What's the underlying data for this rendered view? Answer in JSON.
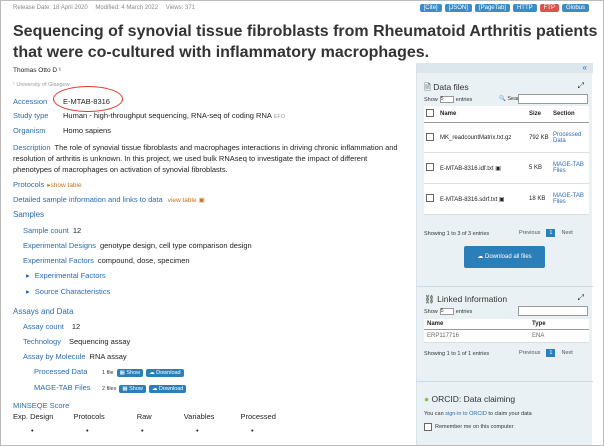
{
  "meta": {
    "release": "Release Date: 18 April 2020",
    "modified": "Modified: 4 March 2022",
    "views": "Views: 371"
  },
  "export_buttons": [
    "[Cite]",
    "[JSON]",
    "[PageTab]",
    "HTTP",
    "FTP",
    "Globus"
  ],
  "title": "Sequencing of synovial tissue fibroblasts from Rheumatoid Arthritis patients that were co-cultured with inflammatory macrophages.",
  "author": "Thomas Otto D ¹",
  "affiliation": "¹ University of Glasgow",
  "accession": {
    "label": "Accession",
    "value": "E-MTAB-8316"
  },
  "study_type": {
    "label": "Study type",
    "value": "Human - high-throughput sequencing, RNA-seq of coding RNA",
    "tag": "EFO"
  },
  "organism": {
    "label": "Organism",
    "value": "Homo sapiens"
  },
  "description": {
    "label": "Description",
    "text": "The role of synovial tissue fibroblasts and macrophages interactions in driving chronic inflammation and resolution of arthritis is unknown. In this project, we used bulk RNAseq to investigate the impact of different phenotypes of macrophages on activation of synovial fibroblasts."
  },
  "protocols": {
    "label": "Protocols",
    "action": "show table"
  },
  "detailed": {
    "label": "Detailed sample information and links to data",
    "action": "view table"
  },
  "samples": {
    "heading": "Samples",
    "count_label": "Sample count",
    "count_value": "12",
    "designs_label": "Experimental Designs",
    "designs_value": "genotype design, cell type comparison design",
    "factors_label": "Experimental Factors",
    "factors_value": "compound, dose, specimen",
    "expand1": "Experimental Factors",
    "expand2": "Source Characteristics"
  },
  "assays": {
    "heading": "Assays and Data",
    "count_label": "Assay count",
    "count_value": "12",
    "tech_label": "Technology",
    "tech_value": "Sequencing assay",
    "molecule_label": "Assay by Molecule",
    "molecule_value": "RNA assay",
    "processed_label": "Processed Data",
    "processed_files": "1 file",
    "magetab_label": "MAGE-TAB Files",
    "magetab_files": "2 files",
    "show_label": "Show",
    "download_label": "Download"
  },
  "minseqe": {
    "heading": "MINSEQE Score",
    "columns": [
      "Exp. Design",
      "Protocols",
      "Raw",
      "Variables",
      "Processed"
    ],
    "values": [
      "•",
      "•",
      "•",
      "•",
      "•"
    ]
  },
  "data_files": {
    "title": "Data files",
    "show": "Show",
    "show_value": "5",
    "entries": "entries",
    "search_label": "Search:",
    "headers": [
      "Name",
      "Size",
      "Section"
    ],
    "rows": [
      {
        "name": "MK_readcountMatrix.txt.gz",
        "size": "792 KB",
        "section": "Processed Data"
      },
      {
        "name": "E-MTAB-8316.idf.txt",
        "size": "5 KB",
        "section": "MAGE-TAB Files"
      },
      {
        "name": "E-MTAB-8316.sdrf.txt",
        "size": "18 KB",
        "section": "MAGE-TAB Files"
      }
    ],
    "info": "Showing 1 to 3 of 3 entries",
    "previous": "Previous",
    "page": "1",
    "next": "Next",
    "download_all": "Download all files"
  },
  "linked": {
    "title": "Linked Information",
    "show": "Show",
    "show_value": "5",
    "entries": "entries",
    "headers": [
      "Name",
      "Type"
    ],
    "rows": [
      {
        "name": "ERP117716",
        "type": "ENA"
      }
    ],
    "info": "Showing 1 to 1 of 1 entries",
    "previous": "Previous",
    "page": "1",
    "next": "Next"
  },
  "orcid": {
    "title": "ORCID: Data claiming",
    "text_pre": "You can",
    "link": "sign-in to ORCID",
    "text_post": "to claim your data",
    "remember": "Remember me on this computer"
  }
}
